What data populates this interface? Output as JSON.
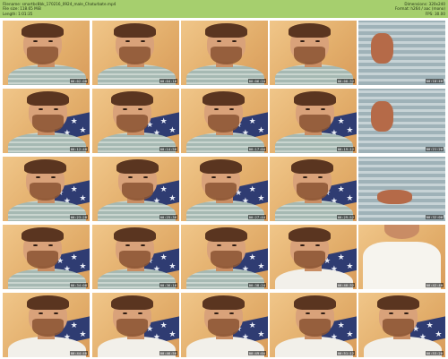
{
  "header": {
    "filename": "Filename: smartbc8bk_170216_0924_male_Chaturbate.mp4",
    "filesize": "File size: 118.65 MiB",
    "length": "Length: 1:01:35",
    "dimensions": "Dimensions: 320x240",
    "format": "Format: h264 / aac (mono)",
    "fps": "FPS: 30.00"
  },
  "thumbnails": [
    {
      "time": "00:02:08",
      "kind": "face",
      "variant": "shirt"
    },
    {
      "time": "00:04:16",
      "kind": "face",
      "variant": "shirt"
    },
    {
      "time": "00:06:24",
      "kind": "face",
      "variant": "shirt"
    },
    {
      "time": "00:08:32",
      "kind": "face",
      "variant": "shirt"
    },
    {
      "time": "00:10:40",
      "kind": "closeup",
      "variant": "shirt"
    },
    {
      "time": "00:12:48",
      "kind": "face",
      "variant": "pillow"
    },
    {
      "time": "00:14:56",
      "kind": "face",
      "variant": "pillow"
    },
    {
      "time": "00:17:04",
      "kind": "face",
      "variant": "pillow"
    },
    {
      "time": "00:19:12",
      "kind": "face",
      "variant": "pillow"
    },
    {
      "time": "00:21:20",
      "kind": "closeup",
      "variant": "shirt"
    },
    {
      "time": "00:23:28",
      "kind": "face",
      "variant": "pillow"
    },
    {
      "time": "00:25:36",
      "kind": "face",
      "variant": "pillow"
    },
    {
      "time": "00:27:44",
      "kind": "face",
      "variant": "pillow"
    },
    {
      "time": "00:29:52",
      "kind": "face",
      "variant": "pillow"
    },
    {
      "time": "00:32:00",
      "kind": "closeup",
      "variant": "hand"
    },
    {
      "time": "00:34:08",
      "kind": "face",
      "variant": "pillow"
    },
    {
      "time": "00:36:16",
      "kind": "face",
      "variant": "pillow"
    },
    {
      "time": "00:38:24",
      "kind": "face",
      "variant": "pillow"
    },
    {
      "time": "00:40:32",
      "kind": "face",
      "variant": "tank"
    },
    {
      "time": "00:42:40",
      "kind": "tank",
      "variant": "tank"
    },
    {
      "time": "00:44:48",
      "kind": "face",
      "variant": "tank"
    },
    {
      "time": "00:46:56",
      "kind": "face",
      "variant": "tank"
    },
    {
      "time": "00:49:04",
      "kind": "face",
      "variant": "tank"
    },
    {
      "time": "00:51:12",
      "kind": "face",
      "variant": "tank"
    },
    {
      "time": "00:53:20",
      "kind": "face",
      "variant": "tank"
    }
  ],
  "colors": {
    "header_bg": "#a6cf6e",
    "header_text": "#1e2d12",
    "wall": "#e7b977",
    "pillow": "#2f3c72"
  }
}
